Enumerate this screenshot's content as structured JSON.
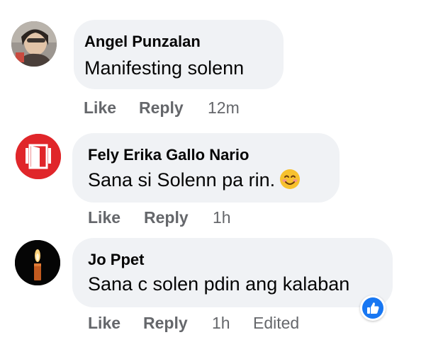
{
  "comments": [
    {
      "author": "Angel Punzalan",
      "text": "Manifesting solenn",
      "avatar_icon": "profile-photo-icon",
      "actions": {
        "like": "Like",
        "reply": "Reply",
        "time": "12m"
      }
    },
    {
      "author": "Fely Erika Gallo Nario",
      "text": "Sana si Solenn pa rin.",
      "emoji": "smiling-face-icon",
      "avatar_icon": "red-door-logo-icon",
      "actions": {
        "like": "Like",
        "reply": "Reply",
        "time": "1h"
      }
    },
    {
      "author": "Jo Ppet",
      "text": "Sana c solen pdin ang kalaban",
      "avatar_icon": "candle-icon",
      "actions": {
        "like": "Like",
        "reply": "Reply",
        "time": "1h",
        "edited": "Edited"
      },
      "reaction": "thumbs-up-icon"
    }
  ],
  "colors": {
    "bubble": "#f0f2f5",
    "meta_text": "#65676b",
    "like_blue": "#1877f2",
    "avatar_red": "#e0262a"
  }
}
